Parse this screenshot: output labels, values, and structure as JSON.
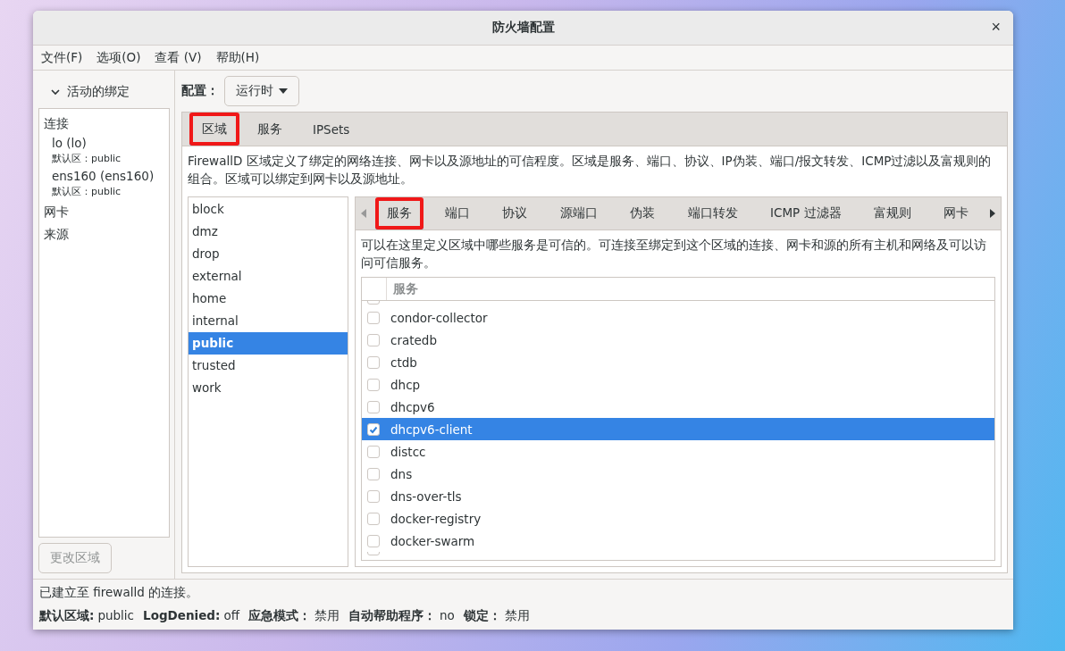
{
  "window": {
    "title": "防火墙配置",
    "close": "×"
  },
  "menu": [
    "文件(F)",
    "选项(O)",
    "查看 (V)",
    "帮助(H)"
  ],
  "sidebar": {
    "header": {
      "label": "活动的绑定",
      "expanded": true
    },
    "groups": [
      {
        "label": "连接",
        "items": [
          {
            "name": "lo (lo)",
            "detail": "默认区：public"
          },
          {
            "name": "ens160 (ens160)",
            "detail": "默认区：public"
          }
        ]
      },
      {
        "label": "网卡"
      },
      {
        "label": "来源"
      }
    ],
    "button": {
      "label": "更改区域",
      "disabled": true
    }
  },
  "config": {
    "label": "配置：",
    "value": "运行时"
  },
  "tabs": [
    {
      "label": "区域",
      "selected": true,
      "highlighted": true
    },
    {
      "label": "服务",
      "selected": false,
      "highlighted": false
    },
    {
      "label": "IPSets",
      "selected": false,
      "highlighted": false
    }
  ],
  "zone_description": "FirewallD 区域定义了绑定的网络连接、网卡以及源地址的可信程度。区域是服务、端口、协议、IP伪装、端口/报文转发、ICMP过滤以及富规则的组合。区域可以绑定到网卡以及源地址。",
  "zones": [
    {
      "name": "block",
      "selected": false
    },
    {
      "name": "dmz",
      "selected": false
    },
    {
      "name": "drop",
      "selected": false
    },
    {
      "name": "external",
      "selected": false
    },
    {
      "name": "home",
      "selected": false
    },
    {
      "name": "internal",
      "selected": false
    },
    {
      "name": "public",
      "selected": true
    },
    {
      "name": "trusted",
      "selected": false
    },
    {
      "name": "work",
      "selected": false
    }
  ],
  "zone_tabs": [
    {
      "label": "服务",
      "selected": true,
      "highlighted": true
    },
    {
      "label": "端口",
      "selected": false,
      "highlighted": false
    },
    {
      "label": "协议",
      "selected": false,
      "highlighted": false
    },
    {
      "label": "源端口",
      "selected": false,
      "highlighted": false
    },
    {
      "label": "伪装",
      "selected": false,
      "highlighted": false
    },
    {
      "label": "端口转发",
      "selected": false,
      "highlighted": false
    },
    {
      "label": "ICMP 过滤器",
      "selected": false,
      "highlighted": false
    },
    {
      "label": "富规则",
      "selected": false,
      "highlighted": false
    },
    {
      "label": "网卡",
      "selected": false,
      "highlighted": false
    }
  ],
  "services_description": "可以在这里定义区域中哪些服务是可信的。可连接至绑定到这个区域的连接、网卡和源的所有主机和网络及可以访问可信服务。",
  "services_table": {
    "columns": [
      "服务"
    ],
    "rows": [
      {
        "name": "condor-collector",
        "checked": false,
        "selected": false
      },
      {
        "name": "cratedb",
        "checked": false,
        "selected": false
      },
      {
        "name": "ctdb",
        "checked": false,
        "selected": false
      },
      {
        "name": "dhcp",
        "checked": false,
        "selected": false
      },
      {
        "name": "dhcpv6",
        "checked": false,
        "selected": false
      },
      {
        "name": "dhcpv6-client",
        "checked": true,
        "selected": true
      },
      {
        "name": "distcc",
        "checked": false,
        "selected": false
      },
      {
        "name": "dns",
        "checked": false,
        "selected": false
      },
      {
        "name": "dns-over-tls",
        "checked": false,
        "selected": false
      },
      {
        "name": "docker-registry",
        "checked": false,
        "selected": false
      },
      {
        "name": "docker-swarm",
        "checked": false,
        "selected": false
      }
    ]
  },
  "status_bar": {
    "message": "已建立至 firewalld 的连接。",
    "fields": [
      {
        "label": "默认区域:",
        "value": "public"
      },
      {
        "label": "LogDenied:",
        "value": "off"
      },
      {
        "label": "应急模式：",
        "value": "禁用"
      },
      {
        "label": "自动帮助程序：",
        "value": "no"
      },
      {
        "label": "锁定：",
        "value": "禁用"
      }
    ]
  }
}
